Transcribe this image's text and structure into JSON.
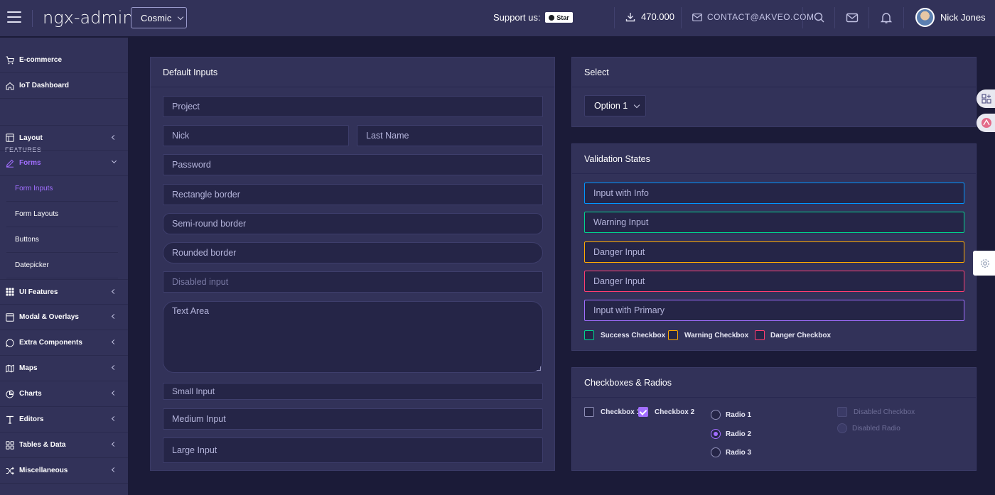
{
  "header": {
    "brand": "ngx-admin",
    "theme": "Cosmic",
    "support_label": "Support us:",
    "star_label": "Star",
    "downloads": "470.000",
    "contact": "CONTACT@AKVEO.COM",
    "user_name": "Nick Jones"
  },
  "sidebar": {
    "items": [
      {
        "label": "E-commerce",
        "icon": "cart-icon"
      },
      {
        "label": "IoT Dashboard",
        "icon": "home-icon"
      },
      {
        "label": "FEATURES"
      },
      {
        "label": "Layout",
        "icon": "layout-icon"
      },
      {
        "label": "Forms",
        "icon": "edit-icon"
      },
      {
        "label": "Form Inputs"
      },
      {
        "label": "Form Layouts"
      },
      {
        "label": "Buttons"
      },
      {
        "label": "Datepicker"
      },
      {
        "label": "UI Features",
        "icon": "keypad-icon"
      },
      {
        "label": "Modal & Overlays",
        "icon": "browser-icon"
      },
      {
        "label": "Extra Components",
        "icon": "message-icon"
      },
      {
        "label": "Maps",
        "icon": "map-icon"
      },
      {
        "label": "Charts",
        "icon": "pie-chart-icon"
      },
      {
        "label": "Editors",
        "icon": "text-icon"
      },
      {
        "label": "Tables & Data",
        "icon": "grid-icon"
      },
      {
        "label": "Miscellaneous",
        "icon": "shuffle-icon"
      }
    ]
  },
  "default_inputs": {
    "title": "Default Inputs",
    "project_placeholder": "Project",
    "nick_placeholder": "Nick",
    "last_name_placeholder": "Last Name",
    "password_placeholder": "Password",
    "rect_placeholder": "Rectangle border",
    "semi_placeholder": "Semi-round border",
    "round_placeholder": "Rounded border",
    "disabled_placeholder": "Disabled input",
    "textarea_placeholder": "Text Area",
    "small_placeholder": "Small Input",
    "medium_placeholder": "Medium Input",
    "large_placeholder": "Large Input"
  },
  "select_card": {
    "title": "Select",
    "selected": "Option 1"
  },
  "validation": {
    "title": "Validation States",
    "info": "Input with Info",
    "warning": "Warning Input",
    "danger1": "Danger Input",
    "danger2": "Danger Input",
    "primary": "Input with Primary",
    "success_cb": "Success Checkbox",
    "warning_cb": "Warning Checkbox",
    "danger_cb": "Danger Checkbox",
    "colors": {
      "info": "#0095ff",
      "success": "#00d68f",
      "warning": "#ffaa00",
      "danger": "#ff3d71",
      "primary": "#a16eff"
    }
  },
  "checks": {
    "title": "Checkboxes & Radios",
    "cb1": "Checkbox 1",
    "cb2": "Checkbox 2",
    "r1": "Radio 1",
    "r2": "Radio 2",
    "r3": "Radio 3",
    "disabled_cb": "Disabled Checkbox",
    "disabled_radio": "Disabled Radio"
  }
}
